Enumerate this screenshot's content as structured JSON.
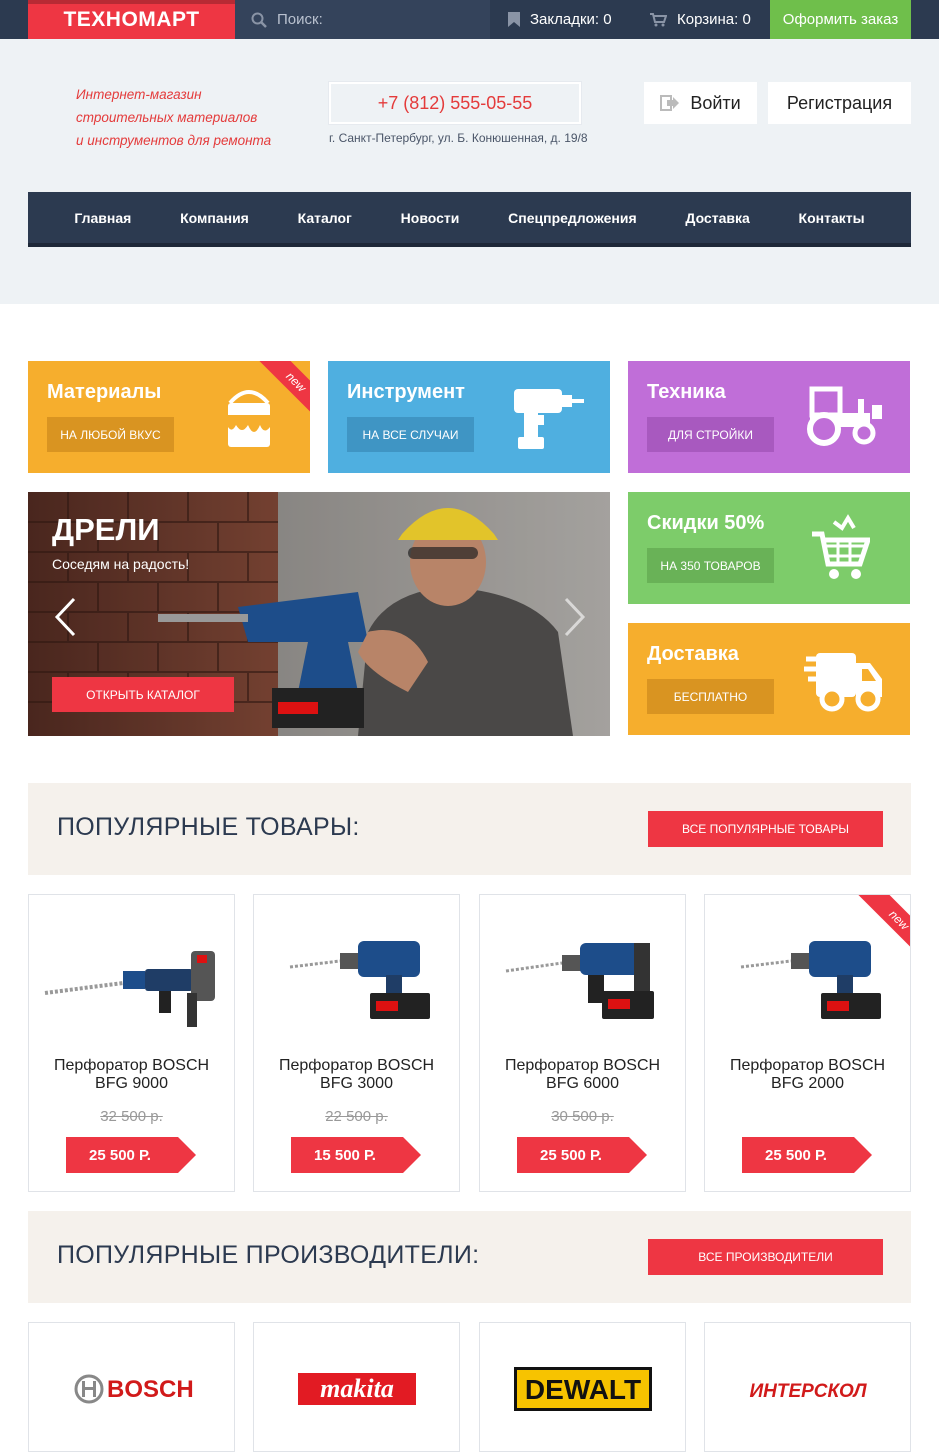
{
  "topbar": {
    "logo": "ТЕХНОМАРТ",
    "search_placeholder": "Поиск:",
    "bookmarks": "Закладки: 0",
    "cart": "Корзина: 0",
    "order_button": "Оформить заказ"
  },
  "header": {
    "tagline_1": "Интернет-магазин",
    "tagline_2": "строительных материалов",
    "tagline_3": "и инструментов для ремонта",
    "phone": "+7 (812) 555-05-55",
    "address": "г. Санкт-Петербург, ул. Б. Конюшенная, д. 19/8",
    "login": "Войти",
    "register": "Регистрация"
  },
  "nav": {
    "items": [
      "Главная",
      "Компания",
      "Каталог",
      "Новости",
      "Спецпредложения",
      "Доставка",
      "Контакты"
    ]
  },
  "tiles": {
    "materials": {
      "title": "Материалы",
      "button": "НА ЛЮБОЙ ВКУС",
      "ribbon": "new",
      "color": "#f6ae2d"
    },
    "tools": {
      "title": "Инструмент",
      "button": "НА ВСЕ СЛУЧАИ",
      "color": "#4fafe0"
    },
    "machinery": {
      "title": "Техника",
      "button": "ДЛЯ СТРОЙКИ",
      "color": "#c06ed8"
    },
    "discount": {
      "title": "Скидки 50%",
      "button": "НА 350 ТОВАРОВ",
      "color": "#7dcc6a"
    },
    "delivery": {
      "title": "Доставка",
      "button": "БЕСПЛАТНО",
      "color": "#f6ae2d"
    }
  },
  "slider": {
    "title": "ДРЕЛИ",
    "subtitle": "Соседям на радость!",
    "button": "ОТКРЫТЬ КАТАЛОГ"
  },
  "popular": {
    "heading": "ПОПУЛЯРНЫЕ ТОВАРЫ:",
    "button": "ВСЕ ПОПУЛЯРНЫЕ ТОВАРЫ",
    "products": [
      {
        "name": "Перфоратор BOSCH BFG 9000",
        "old_price": "32 500 р.",
        "price": "25 500 Р."
      },
      {
        "name": "Перфоратор BOSCH BFG 3000",
        "old_price": "22 500 р.",
        "price": "15 500 Р."
      },
      {
        "name": "Перфоратор BOSCH BFG 6000",
        "old_price": "30 500 р.",
        "price": "25 500 Р."
      },
      {
        "name": "Перфоратор BOSCH BFG 2000",
        "old_price": "",
        "price": "25 500 Р.",
        "ribbon": "new"
      }
    ]
  },
  "brands": {
    "heading": "ПОПУЛЯРНЫЕ ПРОИЗВОДИТЕЛИ:",
    "button": "ВСЕ ПРОИЗВОДИТЕЛИ",
    "items": [
      "BOSCH",
      "makita",
      "DEWALT",
      "ИНТЕРСКОЛ"
    ]
  },
  "colors": {
    "accent": "#ee3643",
    "dark": "#2c3a50",
    "green": "#6fbf4b"
  }
}
